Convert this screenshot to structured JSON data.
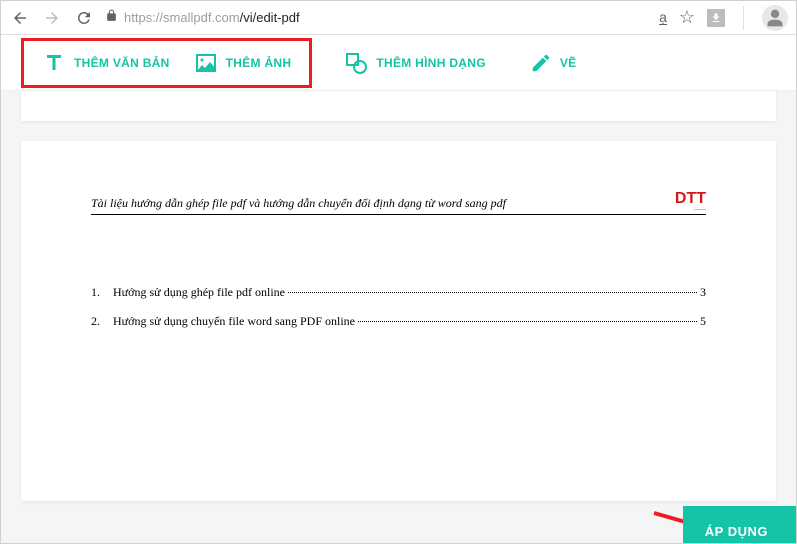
{
  "browser": {
    "url_host": "https://smallpdf.com",
    "url_path": "/vi/edit-pdf",
    "translate_label": "ạ"
  },
  "toolbar": {
    "text_label": "THÊM VĂN BẢN",
    "image_label": "THÊM ẢNH",
    "shape_label": "THÊM HÌNH DẠNG",
    "draw_label": "VẼ"
  },
  "doc": {
    "title": "Tài liệu hướng dẫn ghép file pdf và hướng dẫn chuyển đổi định dạng từ word sang pdf",
    "logo": "DTT",
    "toc": [
      {
        "num": "1.",
        "label": "Hướng sử dụng ghép file pdf online",
        "page": "3"
      },
      {
        "num": "2.",
        "label": "Hướng sử dụng chuyển file word sang PDF online",
        "page": "5"
      }
    ]
  },
  "footer": {
    "apply_label": "ÁP DỤNG"
  },
  "colors": {
    "accent": "#15c3a7",
    "highlight": "#ed1c24"
  }
}
